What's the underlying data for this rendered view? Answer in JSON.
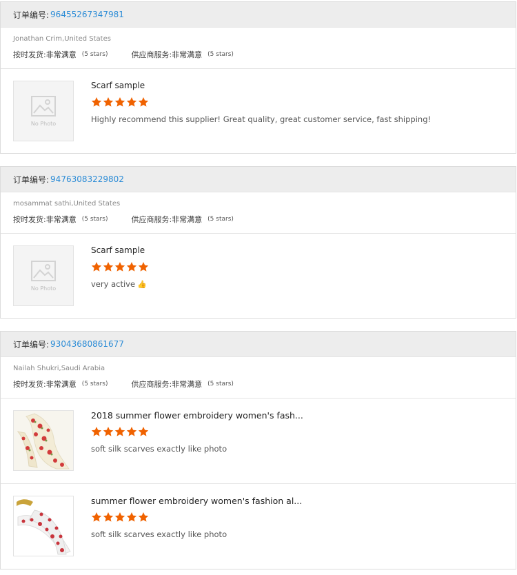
{
  "orders": [
    {
      "order_label": "订单编号:",
      "order_no": "96455267347981",
      "buyer": "Jonathan Crim,United States",
      "shipping_label": "按时发货:",
      "shipping_value": "非常满意",
      "shipping_stars": "(5 stars)",
      "service_label": "供应商服务:",
      "service_value": "非常满意",
      "service_stars": "(5 stars)",
      "products": [
        {
          "title": "Scarf sample",
          "stars": 5,
          "comment": "Highly recommend this supplier! Great quality, great customer service, fast shipping!",
          "photo": "No Photo"
        }
      ]
    },
    {
      "order_label": "订单编号:",
      "order_no": "94763083229802",
      "buyer": "mosammat sathi,United States",
      "shipping_label": "按时发货:",
      "shipping_value": "非常满意",
      "shipping_stars": "(5 stars)",
      "service_label": "供应商服务:",
      "service_value": "非常满意",
      "service_stars": "(5 stars)",
      "products": [
        {
          "title": "Scarf sample",
          "stars": 5,
          "comment": "very active",
          "emoji": "👍",
          "photo": "No Photo"
        }
      ]
    },
    {
      "order_label": "订单编号:",
      "order_no": "93043680861677",
      "buyer": "Nailah Shukri,Saudi Arabia",
      "shipping_label": "按时发货:",
      "shipping_value": "非常满意",
      "shipping_stars": "(5 stars)",
      "service_label": "供应商服务:",
      "service_value": "非常满意",
      "service_stars": "(5 stars)",
      "products": [
        {
          "title": "2018 summer flower embroidery women's fash...",
          "stars": 5,
          "comment": "soft silk scarves exactly like photo"
        },
        {
          "title": "summer flower embroidery women's fashion al...",
          "stars": 5,
          "comment": "soft silk scarves exactly like photo"
        }
      ]
    }
  ],
  "colors": {
    "star": "#f06200",
    "link": "#2a8bd6",
    "header_bg": "#ededed"
  }
}
